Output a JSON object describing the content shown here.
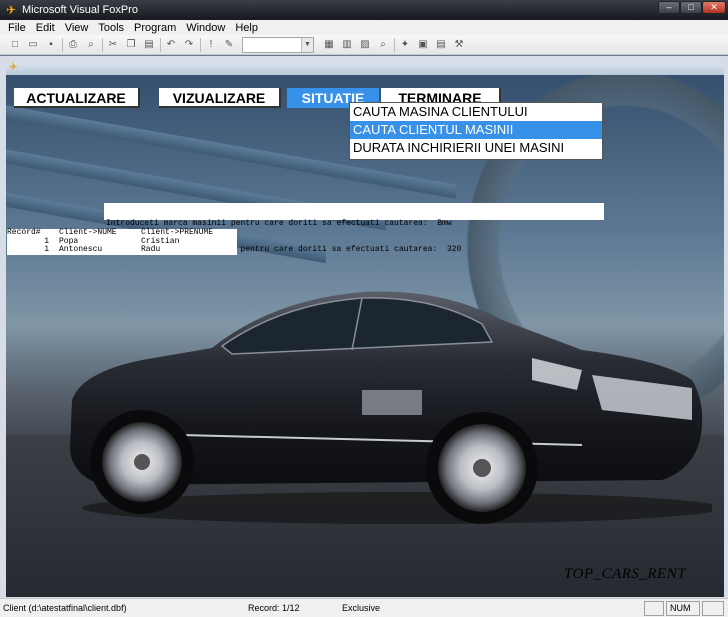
{
  "window": {
    "title": "Microsoft Visual FoxPro"
  },
  "menu": [
    "File",
    "Edit",
    "View",
    "Tools",
    "Program",
    "Window",
    "Help"
  ],
  "app_menu": {
    "items": [
      "ACTUALIZARE",
      "VIZUALIZARE",
      "SITUATIE",
      "TERMINARE"
    ],
    "active": "SITUATIE"
  },
  "dropdown": {
    "items": [
      "CAUTA MASINA CLIENTULUI",
      "CAUTA CLIENTUL MASINII",
      "DURATA INCHIRIERII UNEI MASINI"
    ],
    "selected": "CAUTA CLIENTUL MASINII"
  },
  "prompt": {
    "line1": "Introduceti marca masinii pentru care doriti sa efectuati cautarea:  Bmw",
    "line2": "Introduceti modelul masinii pentru care doriti sa efectuati cautarea:  320"
  },
  "browse": {
    "headers": [
      "Record#",
      "Client->NUME",
      "Client->PRENUME"
    ],
    "rows": [
      [
        "1",
        "Popa",
        "Cristian"
      ],
      [
        "1",
        "Antonescu",
        "Radu"
      ]
    ]
  },
  "brand": "TOP_CARS_RENT",
  "status": {
    "table": "Client (d:\\atestatfinal\\client.dbf)",
    "record": "Record: 1/12",
    "mode": "Exclusive",
    "num": "NUM"
  },
  "colors": {
    "accent": "#3891e8"
  },
  "icons": [
    "foxpro-icon",
    "new-icon",
    "open-icon",
    "save-icon",
    "print-icon",
    "preview-icon",
    "cut-icon",
    "copy-icon",
    "paste-icon",
    "undo-icon",
    "redo-icon",
    "run-icon",
    "modify-icon"
  ]
}
